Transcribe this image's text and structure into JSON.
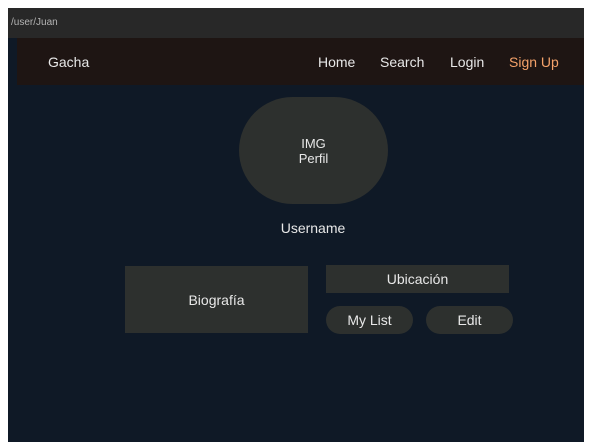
{
  "address_bar": {
    "path": "/user/Juan"
  },
  "navbar": {
    "brand": "Gacha",
    "links": [
      {
        "label": "Home"
      },
      {
        "label": "Search"
      },
      {
        "label": "Login"
      },
      {
        "label": "Sign Up",
        "color": "#f5a26a"
      }
    ]
  },
  "profile": {
    "image_placeholder": {
      "line1": "IMG",
      "line2": "Perfil"
    },
    "username": "Username",
    "biography": "Biografía",
    "location": "Ubicación",
    "buttons": {
      "my_list": "My List",
      "edit": "Edit"
    }
  },
  "colors": {
    "page_background": "#0f1926",
    "navbar_background": "#1e1513",
    "card_background": "#2d302e",
    "accent": "#f5a26a",
    "text": "#e8e8e8"
  }
}
